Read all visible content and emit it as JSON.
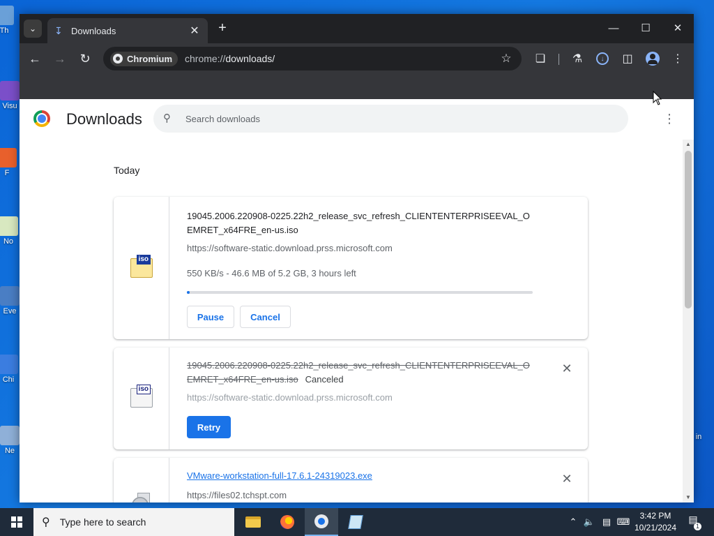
{
  "desktop": {
    "icons": [
      {
        "label": "Th"
      },
      {
        "label": "Visu"
      },
      {
        "label": "F"
      },
      {
        "label": "No"
      },
      {
        "label": "Eve"
      },
      {
        "label": "Chi"
      },
      {
        "label": "Ne"
      },
      {
        "label": "in"
      }
    ]
  },
  "browser": {
    "tab": {
      "title": "Downloads"
    },
    "omnibox": {
      "chip_label": "Chromium",
      "url_scheme": "chrome://",
      "url_path": "downloads/"
    }
  },
  "page": {
    "title": "Downloads",
    "search_placeholder": "Search downloads",
    "date_heading": "Today",
    "items": [
      {
        "file_name": "19045.2006.220908-0225.22h2_release_svc_refresh_CLIENTENTERPRISEEVAL_OEMRET_x64FRE_en-us.iso",
        "url": "https://software-static.download.prss.microsoft.com",
        "progress_text": "550 KB/s - 46.6 MB of 5.2 GB, 3 hours left",
        "progress_fraction": 0.009,
        "pause_label": "Pause",
        "cancel_label": "Cancel",
        "icon_tag": "iso"
      },
      {
        "file_name": "19045.2006.220908-0225.22h2_release_svc_refresh_CLIENTENTERPRISEEVAL_OEMRET_x64FRE_en-us.iso",
        "status": "Canceled",
        "url": "https://software-static.download.prss.microsoft.com",
        "retry_label": "Retry",
        "icon_tag": "iso"
      },
      {
        "file_name": "VMware-workstation-full-17.6.1-24319023.exe",
        "url": "https://files02.tchspt.com"
      }
    ]
  },
  "taskbar": {
    "search_text": "Type here to search",
    "time": "3:42 PM",
    "date": "10/21/2024",
    "notification_count": "1"
  },
  "colors": {
    "accent": "#1a73e8",
    "titlebar": "#202124",
    "toolbar": "#35363a"
  }
}
